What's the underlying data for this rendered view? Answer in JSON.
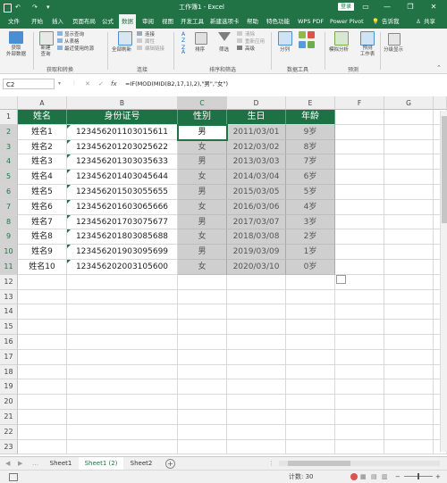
{
  "window": {
    "title": "工作簿1 - Excel",
    "login_label": "登录",
    "minimize": "—",
    "restore": "❐",
    "close": "✕"
  },
  "quick_access": {
    "undo": "↶",
    "redo": "↷"
  },
  "tabs": [
    {
      "label": "文件"
    },
    {
      "label": "开始"
    },
    {
      "label": "插入"
    },
    {
      "label": "页面布局"
    },
    {
      "label": "公式"
    },
    {
      "label": "数据",
      "active": true
    },
    {
      "label": "审阅"
    },
    {
      "label": "视图"
    },
    {
      "label": "开发工具"
    },
    {
      "label": "新建选项卡"
    },
    {
      "label": "帮助"
    },
    {
      "label": "特色功能"
    },
    {
      "label": "WPS PDF"
    },
    {
      "label": "Power Pivot"
    },
    {
      "label": "告诉我"
    },
    {
      "label": "共享"
    }
  ],
  "ribbon": {
    "get_external_data": "获取\n外部数据",
    "new_query": "新建\n查询",
    "show_queries": "显示查询",
    "from_table": "从表格",
    "recent_sources": "最近使用的源",
    "group_get_transform": "获取和转换",
    "refresh_all": "全部刷新",
    "connections": "连接",
    "properties": "属性",
    "edit_links": "编辑链接",
    "group_connections": "连接",
    "sort": "排序",
    "filter": "筛选",
    "clear": "清除",
    "reapply": "重新应用",
    "advanced": "高级",
    "group_sort_filter": "排序和筛选",
    "text_to_columns": "分列",
    "group_data_tools": "数据工具",
    "what_if": "模拟分析",
    "forecast_sheet": "预测\n工作表",
    "group_forecast": "预测",
    "outline": "分级显示"
  },
  "formula_bar": {
    "name_box": "C2",
    "cancel": "✕",
    "enter": "✓",
    "fx": "fx",
    "formula": "=IF(MOD(MID(B2,17,1),2),\"男\",\"女\")"
  },
  "grid": {
    "columns": [
      "A",
      "B",
      "C",
      "D",
      "E",
      "F",
      "G"
    ],
    "rows": [
      "1",
      "2",
      "3",
      "4",
      "5",
      "6",
      "7",
      "8",
      "9",
      "10",
      "11",
      "12",
      "13",
      "14",
      "15",
      "16",
      "17",
      "18",
      "19",
      "20",
      "21",
      "22",
      "23"
    ],
    "headers": [
      "姓名",
      "身份证号",
      "性别",
      "生日",
      "年龄"
    ],
    "data": [
      [
        "姓名1",
        "123456201103015611",
        "男",
        "2011/03/01",
        "9岁"
      ],
      [
        "姓名2",
        "123456201203025622",
        "女",
        "2012/03/02",
        "8岁"
      ],
      [
        "姓名3",
        "123456201303035633",
        "男",
        "2013/03/03",
        "7岁"
      ],
      [
        "姓名4",
        "123456201403045644",
        "女",
        "2014/03/04",
        "6岁"
      ],
      [
        "姓名5",
        "123456201503055655",
        "男",
        "2015/03/05",
        "5岁"
      ],
      [
        "姓名6",
        "123456201603065666",
        "女",
        "2016/03/06",
        "4岁"
      ],
      [
        "姓名7",
        "123456201703075677",
        "男",
        "2017/03/07",
        "3岁"
      ],
      [
        "姓名8",
        "123456201803085688",
        "女",
        "2018/03/08",
        "2岁"
      ],
      [
        "姓名9",
        "123456201903095699",
        "男",
        "2019/03/09",
        "1岁"
      ],
      [
        "姓名10",
        "123456202003105600",
        "女",
        "2020/03/10",
        "0岁"
      ]
    ]
  },
  "sheets": [
    {
      "label": "Sheet1"
    },
    {
      "label": "Sheet1 (2)",
      "active": true
    },
    {
      "label": "Sheet2"
    }
  ],
  "add_sheet": "+",
  "status": {
    "count": "计数: 30",
    "zoom_minus": "−",
    "zoom_plus": "+"
  },
  "colors": {
    "excel_green": "#217346",
    "header_fill": "#1e7145",
    "gray_fill": "#cfcfcf"
  }
}
